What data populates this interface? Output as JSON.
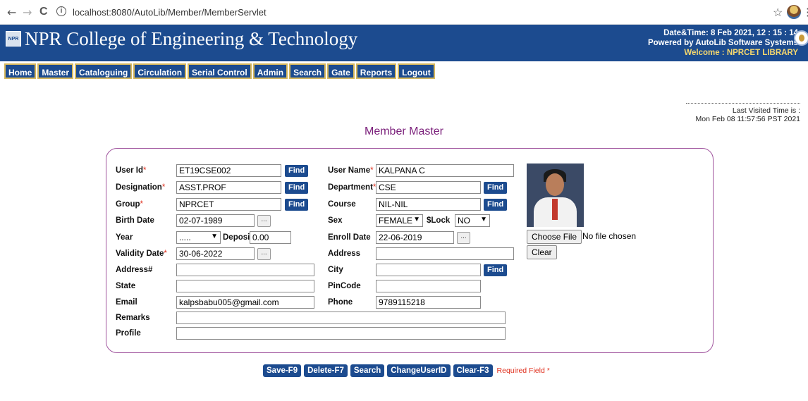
{
  "browser": {
    "url": "localhost:8080/AutoLib/Member/MemberServlet",
    "back_icon": "←",
    "forward_icon": "→",
    "reload_icon": "C",
    "info_icon": "i",
    "star_icon": "☆",
    "more_icon": "⋮"
  },
  "header": {
    "logo_text": "NPR",
    "college_name": "NPR College of Engineering & Technology",
    "datetime": "Date&Time:  8 Feb 2021, 12 : 15 : 14",
    "powered_by": "Powered by AutoLib Software Systems",
    "welcome": "Welcome   :  NPRCET LIBRARY"
  },
  "menu": [
    "Home",
    "Master",
    "Cataloguing",
    "Circulation",
    "Serial Control",
    "Admin",
    "Search",
    "Gate",
    "Reports",
    "Logout"
  ],
  "last_visit": {
    "label": "Last Visited Time is :",
    "value": "Mon Feb 08 11:57:56 PST 2021"
  },
  "page_title": "Member Master",
  "form": {
    "user_id": {
      "label": "User Id",
      "value": "ET19CSE002"
    },
    "designation": {
      "label": "Designation",
      "value": "ASST.PROF"
    },
    "group": {
      "label": "Group",
      "value": "NPRCET"
    },
    "birth_date": {
      "label": "Birth Date",
      "value": "02-07-1989"
    },
    "year": {
      "label": "Year",
      "value": "....."
    },
    "deposit": {
      "label": "Deposit",
      "value": "0.00"
    },
    "validity_date": {
      "label": "Validity Date",
      "value": "30-06-2022"
    },
    "address_hash": {
      "label": "Address#",
      "value": ""
    },
    "state": {
      "label": "State",
      "value": ""
    },
    "email": {
      "label": "Email",
      "value": "kalpsbabu005@gmail.com"
    },
    "remarks": {
      "label": "Remarks",
      "value": ""
    },
    "profile": {
      "label": "Profile",
      "value": ""
    },
    "user_name": {
      "label": "User Name",
      "value": "KALPANA C"
    },
    "department": {
      "label": "Department",
      "value": "CSE"
    },
    "course": {
      "label": "Course",
      "value": "NIL-NIL"
    },
    "sex": {
      "label": "Sex",
      "value": "FEMALE"
    },
    "slock": {
      "label": "$Lock",
      "value": "NO"
    },
    "enroll_date": {
      "label": "Enroll Date",
      "value": "22-06-2019"
    },
    "address": {
      "label": "Address",
      "value": ""
    },
    "city": {
      "label": "City",
      "value": ""
    },
    "pincode": {
      "label": "PinCode",
      "value": ""
    },
    "phone": {
      "label": "Phone",
      "value": "9789115218"
    },
    "find_label": "Find",
    "dots_label": "...",
    "req_mark": "*",
    "choose_file": "Choose File",
    "no_file": "No file chosen",
    "clear": "Clear"
  },
  "actions": {
    "save": "Save-F9",
    "delete": "Delete-F7",
    "search": "Search",
    "change_user": "ChangeUserID",
    "clear": "Clear-F3",
    "required_note": "Required Field *"
  }
}
